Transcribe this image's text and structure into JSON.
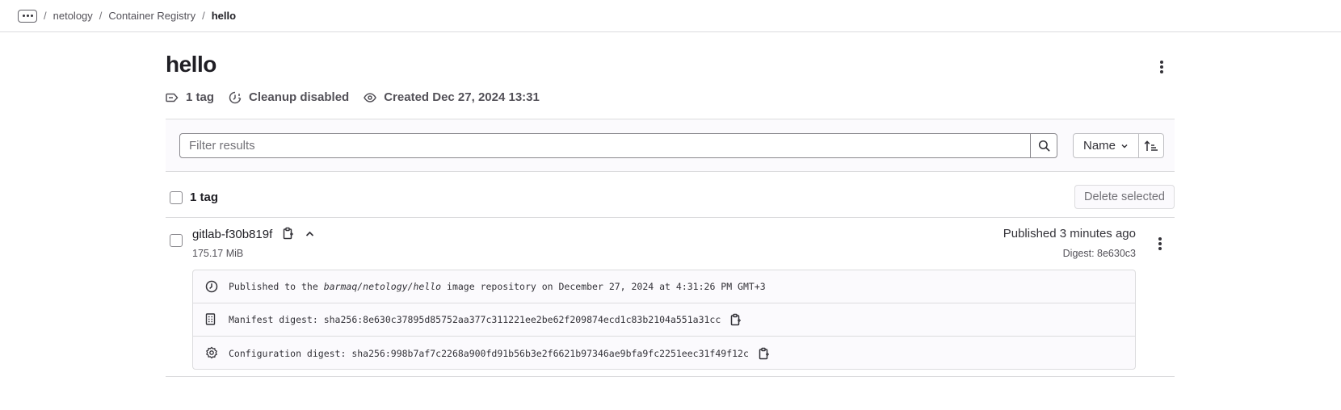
{
  "breadcrumb": {
    "items": [
      "netology",
      "Container Registry",
      "hello"
    ],
    "separator": "/"
  },
  "page": {
    "title": "hello"
  },
  "meta": {
    "tags": "1 tag",
    "cleanup": "Cleanup disabled",
    "created": "Created Dec 27, 2024 13:31"
  },
  "filter": {
    "placeholder": "Filter results",
    "sort_label": "Name"
  },
  "list": {
    "count_label": "1 tag",
    "delete_label": "Delete selected"
  },
  "tag": {
    "name": "gitlab-f30b819f",
    "size": "175.17 MiB",
    "published": "Published 3 minutes ago",
    "digest_short": "Digest: 8e630c3",
    "details": {
      "published_prefix": "Published to the ",
      "repository": "barmaq/netology/hello",
      "published_suffix": " image repository on December 27, 2024 at 4:31:26 PM GMT+3",
      "manifest": "Manifest digest: sha256:8e630c37895d85752aa377c311221ee2be62f209874ecd1c83b2104a551a31cc",
      "configuration": "Configuration digest: sha256:998b7af7c2268a900fd91b56b3e2f6621b97346ae9bfa9fc2251eec31f49f12c"
    }
  },
  "icons": {
    "more": "ellipsis-icon",
    "tag": "label-icon",
    "cleanup": "cleanup-clock-icon",
    "created": "eye-icon",
    "search": "search-icon",
    "sort_dir": "sort-ascending-icon",
    "copy": "copy-to-clipboard-icon",
    "collapse": "chevron-up-icon",
    "clock": "clock-icon",
    "manifest": "document-icon",
    "configuration": "settings-cog-icon"
  }
}
